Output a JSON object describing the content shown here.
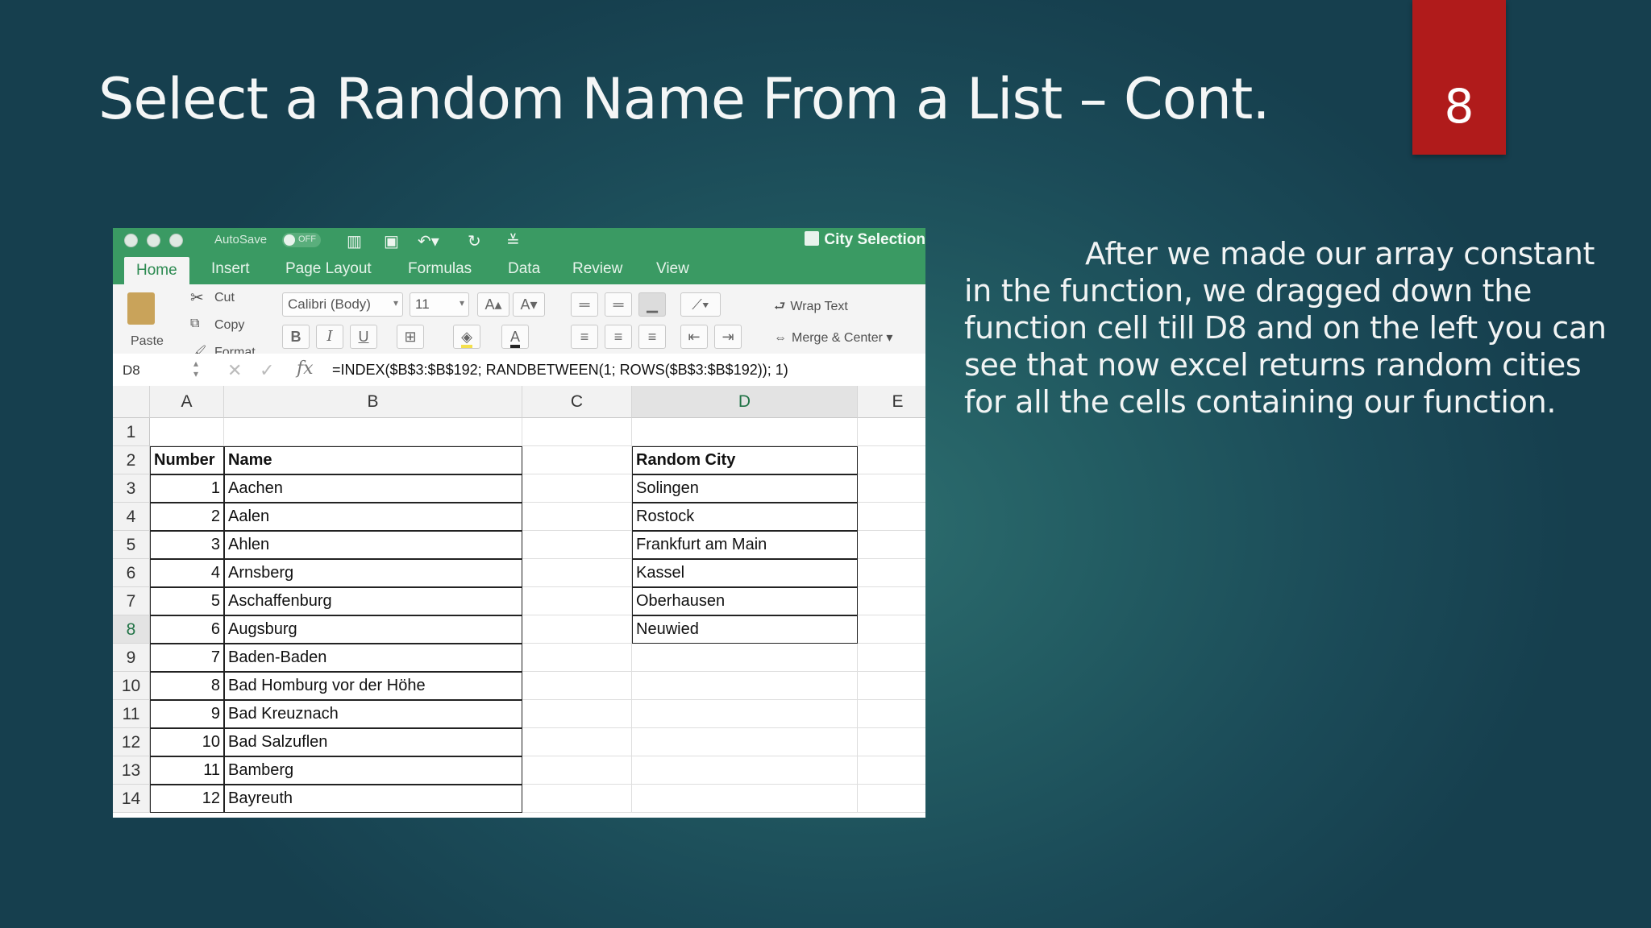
{
  "slide": {
    "title": "Select a Random Name From a List – Cont.",
    "slide_number": "8",
    "body_text": "After we made our array constant in the function, we dragged down the function cell till D8 and on the left you can see that now excel returns random cities for all the cells containing our function."
  },
  "excel": {
    "titlebar": {
      "autosave_label": "AutoSave",
      "autosave_state": "OFF",
      "document_title": "City Selection"
    },
    "tabs": [
      {
        "label": "Home",
        "active": true
      },
      {
        "label": "Insert"
      },
      {
        "label": "Page Layout"
      },
      {
        "label": "Formulas"
      },
      {
        "label": "Data"
      },
      {
        "label": "Review"
      },
      {
        "label": "View"
      }
    ],
    "ribbon": {
      "paste": "Paste",
      "cut": "Cut",
      "copy": "Copy",
      "format": "Format",
      "font_name": "Calibri (Body)",
      "font_size": "11",
      "bold": "B",
      "italic": "I",
      "underline": "U",
      "wrap_text": "Wrap Text",
      "merge_center": "Merge & Center"
    },
    "formula_bar": {
      "name_box": "D8",
      "fx": "fx",
      "formula": "=INDEX($B$3:$B$192; RANDBETWEEN(1; ROWS($B$3:$B$192)); 1)"
    },
    "columns": [
      "A",
      "B",
      "C",
      "D",
      "E"
    ],
    "rows": [
      "1",
      "2",
      "3",
      "4",
      "5",
      "6",
      "7",
      "8",
      "9",
      "10",
      "11",
      "12",
      "13",
      "14"
    ],
    "headers": {
      "number": "Number",
      "name": "Name",
      "random_city": "Random City"
    },
    "list": [
      {
        "number": "1",
        "name": "Aachen"
      },
      {
        "number": "2",
        "name": "Aalen"
      },
      {
        "number": "3",
        "name": "Ahlen"
      },
      {
        "number": "4",
        "name": "Arnsberg"
      },
      {
        "number": "5",
        "name": "Aschaffenburg"
      },
      {
        "number": "6",
        "name": "Augsburg"
      },
      {
        "number": "7",
        "name": "Baden-Baden"
      },
      {
        "number": "8",
        "name": "Bad Homburg vor der Höhe"
      },
      {
        "number": "9",
        "name": "Bad Kreuznach"
      },
      {
        "number": "10",
        "name": "Bad Salzuflen"
      },
      {
        "number": "11",
        "name": "Bamberg"
      },
      {
        "number": "12",
        "name": "Bayreuth"
      }
    ],
    "random_cities": [
      "Solingen",
      "Rostock",
      "Frankfurt am Main",
      "Kassel",
      "Oberhausen",
      "Neuwied"
    ]
  },
  "colors": {
    "accent_red": "#b01b1b",
    "excel_green": "#3a9a63"
  }
}
